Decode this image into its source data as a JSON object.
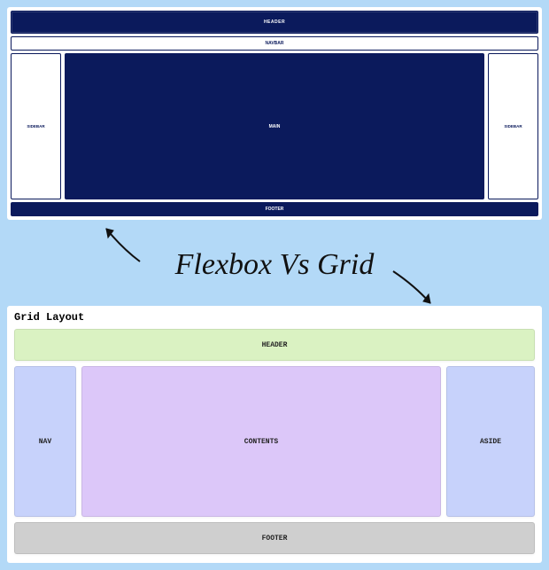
{
  "center_title": "Flexbox Vs Grid",
  "flex": {
    "header": "HEADER",
    "navbar": "NAVBAR",
    "sidebar_left": "SIDEBAR",
    "main": "MAIN",
    "sidebar_right": "SIDEBAR",
    "footer": "FOOTER"
  },
  "grid": {
    "title": "Grid Layout",
    "header": "HEADER",
    "nav": "NAV",
    "contents": "CONTENTS",
    "aside": "ASIDE",
    "footer": "FOOTER"
  }
}
